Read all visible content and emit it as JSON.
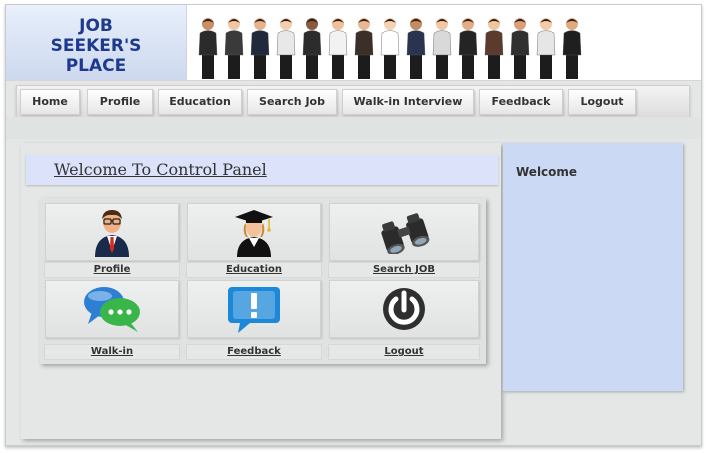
{
  "header": {
    "logo_line1": "JOB",
    "logo_line2": "SEEKER'S",
    "logo_line3": "PLACE"
  },
  "nav": {
    "items": [
      {
        "label": "Home"
      },
      {
        "label": "Profile"
      },
      {
        "label": "Education"
      },
      {
        "label": "Search Job"
      },
      {
        "label": "Walk-in Interview"
      },
      {
        "label": "Feedback"
      },
      {
        "label": "Logout"
      }
    ]
  },
  "panel": {
    "title": "Welcome To Control Panel",
    "tiles": [
      {
        "label": "Profile",
        "icon": "businessman-icon"
      },
      {
        "label": "Education",
        "icon": "graduate-icon"
      },
      {
        "label": "Search JOB",
        "icon": "binoculars-icon"
      },
      {
        "label": "Walk-in",
        "icon": "chat-bubbles-icon"
      },
      {
        "label": "Feedback",
        "icon": "exclamation-bubble-icon"
      },
      {
        "label": "Logout",
        "icon": "power-icon"
      }
    ]
  },
  "sidebar": {
    "title": "Welcome"
  },
  "colors": {
    "logo_text": "#1d3a8f",
    "welcome_bar": "#dde2fb",
    "sidebar": "#ccd9f5",
    "feedback_blue": "#1e88d8",
    "chat_green": "#39b54a"
  }
}
